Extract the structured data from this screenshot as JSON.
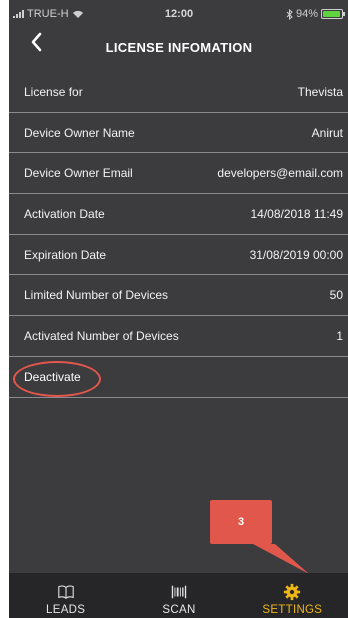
{
  "status_bar": {
    "carrier": "TRUE-H",
    "time": "12:00",
    "bluetooth": "bluetooth-icon",
    "battery_text": "94%",
    "battery_level": 0.94,
    "battery_color": "#5ed33e"
  },
  "header": {
    "title": "LICENSE INFOMATION",
    "back_icon": "chevron-left-icon"
  },
  "license_info": [
    {
      "label": "License for",
      "value": "Thevista"
    },
    {
      "label": "Device Owner Name",
      "value": "Anirut"
    },
    {
      "label": "Device Owner Email",
      "value": "developers@email.com"
    },
    {
      "label": "Activation Date",
      "value": "14/08/2018 11:49"
    },
    {
      "label": "Expiration Date",
      "value": "31/08/2019 00:00"
    },
    {
      "label": "Limited Number of Devices",
      "value": "50"
    },
    {
      "label": "Activated Number of Devices",
      "value": "1"
    }
  ],
  "deactivate_label": "Deactivate",
  "annotation": {
    "callout_number": "3",
    "color": "#e2574c"
  },
  "tabs": [
    {
      "label": "LEADS",
      "icon": "book-icon",
      "active": false
    },
    {
      "label": "SCAN",
      "icon": "barcode-icon",
      "active": false
    },
    {
      "label": "SETTINGS",
      "icon": "gear-icon",
      "active": true
    }
  ],
  "colors": {
    "background": "#3c3c3e",
    "tab_bar": "#262628",
    "accent": "#f0b616"
  }
}
